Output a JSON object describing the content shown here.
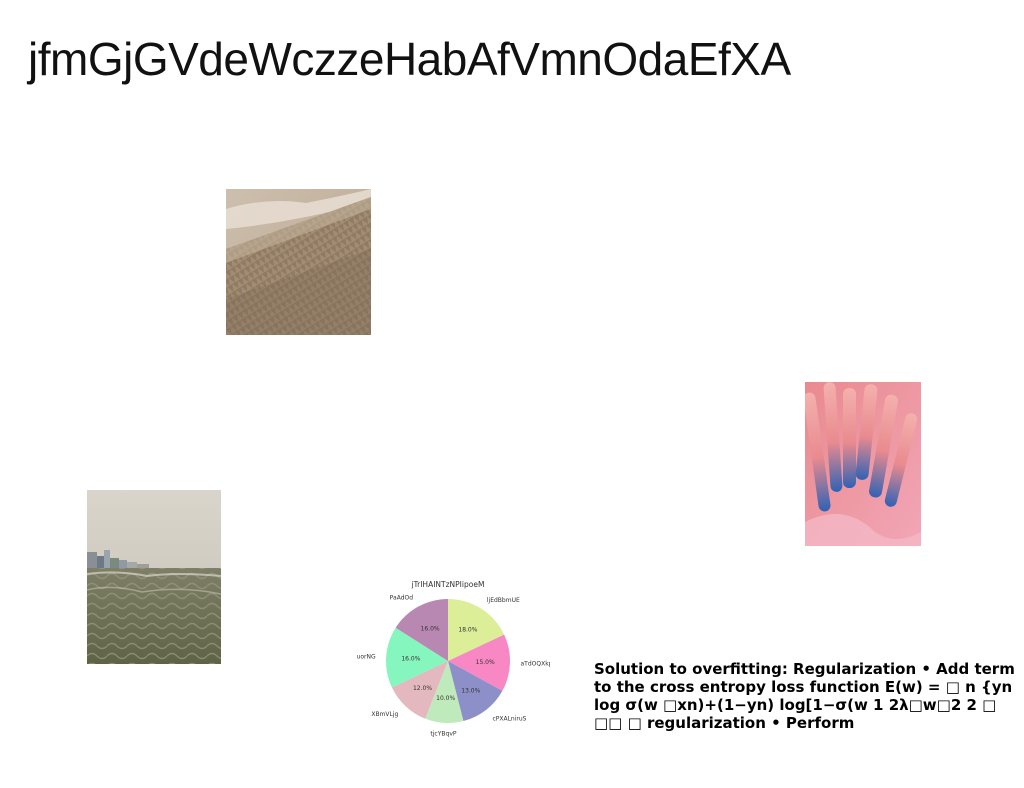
{
  "slide": {
    "title": "jfmGjGVdeWczzeHabAfVmnOdaEfXA",
    "body": "Solution to overfitting: Regularization • Add term to the cross entropy loss function E(w) = □ n {yn log σ(w □xn)+(1−yn) log[1−σ(w 1 2λ□w□2 2 □ □□ □ regularization • Perform"
  },
  "images": {
    "forest": "sepia-forest-hillside-with-fog-photo",
    "sea": "stormy-sea-with-coastal-buildings-photo",
    "coral": "pink-and-blue-coral-closeup-photo"
  },
  "chart_data": {
    "type": "pie",
    "title": "jTrIHAINTzNPIipoeM",
    "slices": [
      {
        "label": "ljEdBbmUE",
        "value": 18.0,
        "pct_label": "18.0%",
        "color": "#dcee98"
      },
      {
        "label": "aTdOQXkp",
        "value": 15.0,
        "pct_label": "15.0%",
        "color": "#f788c4"
      },
      {
        "label": "cPXALniruS",
        "value": 13.0,
        "pct_label": "13.0%",
        "color": "#8c8fc8"
      },
      {
        "label": "tjcYBqvP",
        "value": 10.0,
        "pct_label": "10.0%",
        "color": "#bfeabb"
      },
      {
        "label": "XBmVLjg",
        "value": 12.0,
        "pct_label": "12.0%",
        "color": "#e3b8bf"
      },
      {
        "label": "uorNG",
        "value": 16.0,
        "pct_label": "16.0%",
        "color": "#86f6bf"
      },
      {
        "label": "PaAdOd",
        "value": 16.0,
        "pct_label": "16.0%",
        "color": "#b888b3"
      }
    ],
    "start_angle_deg": 90,
    "direction": "clockwise",
    "legend": "none"
  }
}
